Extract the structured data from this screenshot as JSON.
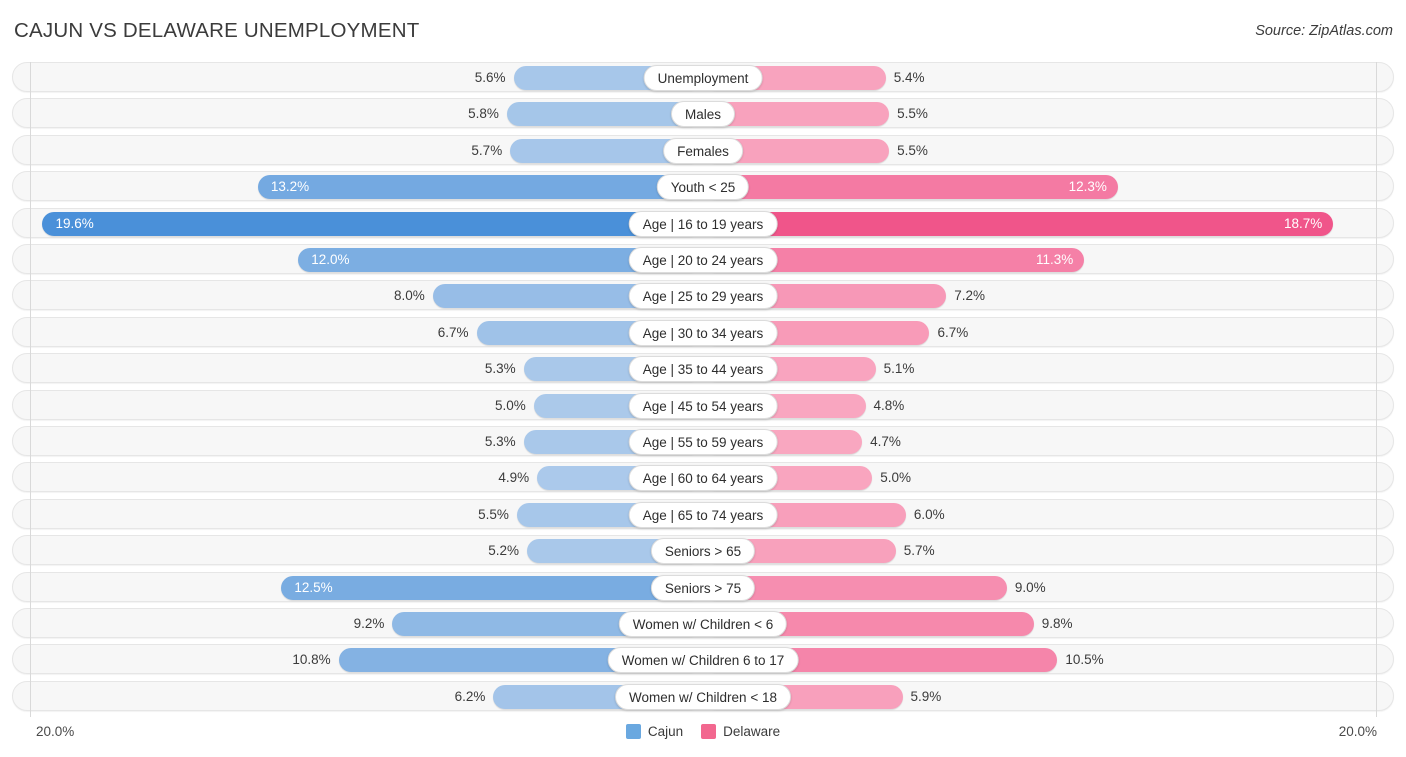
{
  "header": {
    "title": "CAJUN VS DELAWARE UNEMPLOYMENT",
    "source": "Source: ZipAtlas.com"
  },
  "axis": {
    "left_label": "20.0%",
    "right_label": "20.0%",
    "max": 20.0
  },
  "legend": {
    "items": [
      {
        "label": "Cajun",
        "color": "#6aa8e0"
      },
      {
        "label": "Delaware",
        "color": "#f2678f"
      }
    ]
  },
  "chart_data": {
    "type": "bar",
    "title": "CAJUN VS DELAWARE UNEMPLOYMENT",
    "subtitle": "Source: ZipAtlas.com",
    "orientation": "horizontal-diverging",
    "xlabel": "",
    "ylabel": "",
    "xlim": [
      -20.0,
      20.0
    ],
    "axis_tick_labels": [
      "20.0%",
      "20.0%"
    ],
    "grid": false,
    "legend_position": "bottom-center",
    "categories": [
      "Unemployment",
      "Males",
      "Females",
      "Youth < 25",
      "Age | 16 to 19 years",
      "Age | 20 to 24 years",
      "Age | 25 to 29 years",
      "Age | 30 to 34 years",
      "Age | 35 to 44 years",
      "Age | 45 to 54 years",
      "Age | 55 to 59 years",
      "Age | 60 to 64 years",
      "Age | 65 to 74 years",
      "Seniors > 65",
      "Seniors > 75",
      "Women w/ Children < 6",
      "Women w/ Children 6 to 17",
      "Women w/ Children < 18"
    ],
    "series": [
      {
        "name": "Cajun",
        "color": "#6aa8e0",
        "values": [
          5.6,
          5.8,
          5.7,
          13.2,
          19.6,
          12.0,
          8.0,
          6.7,
          5.3,
          5.0,
          5.3,
          4.9,
          5.5,
          5.2,
          12.5,
          9.2,
          10.8,
          6.2
        ],
        "labels": [
          "5.6%",
          "5.8%",
          "5.7%",
          "13.2%",
          "19.6%",
          "12.0%",
          "8.0%",
          "6.7%",
          "5.3%",
          "5.0%",
          "5.3%",
          "4.9%",
          "5.5%",
          "5.2%",
          "12.5%",
          "9.2%",
          "10.8%",
          "6.2%"
        ]
      },
      {
        "name": "Delaware",
        "color": "#f2678f",
        "values": [
          5.4,
          5.5,
          5.5,
          12.3,
          18.7,
          11.3,
          7.2,
          6.7,
          5.1,
          4.8,
          4.7,
          5.0,
          6.0,
          5.7,
          9.0,
          9.8,
          10.5,
          5.9
        ],
        "labels": [
          "5.4%",
          "5.5%",
          "5.5%",
          "12.3%",
          "18.7%",
          "11.3%",
          "7.2%",
          "6.7%",
          "5.1%",
          "4.8%",
          "4.7%",
          "5.0%",
          "6.0%",
          "5.7%",
          "9.0%",
          "9.8%",
          "10.5%",
          "5.9%"
        ]
      }
    ]
  },
  "rows": [
    {
      "category": "Unemployment",
      "left_value": 5.6,
      "left_label": "5.6%",
      "right_value": 5.4,
      "right_label": "5.4%"
    },
    {
      "category": "Males",
      "left_value": 5.8,
      "left_label": "5.8%",
      "right_value": 5.5,
      "right_label": "5.5%"
    },
    {
      "category": "Females",
      "left_value": 5.7,
      "left_label": "5.7%",
      "right_value": 5.5,
      "right_label": "5.5%"
    },
    {
      "category": "Youth < 25",
      "left_value": 13.2,
      "left_label": "13.2%",
      "right_value": 12.3,
      "right_label": "12.3%"
    },
    {
      "category": "Age | 16 to 19 years",
      "left_value": 19.6,
      "left_label": "19.6%",
      "right_value": 18.7,
      "right_label": "18.7%"
    },
    {
      "category": "Age | 20 to 24 years",
      "left_value": 12.0,
      "left_label": "12.0%",
      "right_value": 11.3,
      "right_label": "11.3%"
    },
    {
      "category": "Age | 25 to 29 years",
      "left_value": 8.0,
      "left_label": "8.0%",
      "right_value": 7.2,
      "right_label": "7.2%"
    },
    {
      "category": "Age | 30 to 34 years",
      "left_value": 6.7,
      "left_label": "6.7%",
      "right_value": 6.7,
      "right_label": "6.7%"
    },
    {
      "category": "Age | 35 to 44 years",
      "left_value": 5.3,
      "left_label": "5.3%",
      "right_value": 5.1,
      "right_label": "5.1%"
    },
    {
      "category": "Age | 45 to 54 years",
      "left_value": 5.0,
      "left_label": "5.0%",
      "right_value": 4.8,
      "right_label": "4.8%"
    },
    {
      "category": "Age | 55 to 59 years",
      "left_value": 5.3,
      "left_label": "5.3%",
      "right_value": 4.7,
      "right_label": "4.7%"
    },
    {
      "category": "Age | 60 to 64 years",
      "left_value": 4.9,
      "left_label": "4.9%",
      "right_value": 5.0,
      "right_label": "5.0%"
    },
    {
      "category": "Age | 65 to 74 years",
      "left_value": 5.5,
      "left_label": "5.5%",
      "right_value": 6.0,
      "right_label": "6.0%"
    },
    {
      "category": "Seniors > 65",
      "left_value": 5.2,
      "left_label": "5.2%",
      "right_value": 5.7,
      "right_label": "5.7%"
    },
    {
      "category": "Seniors > 75",
      "left_value": 12.5,
      "left_label": "12.5%",
      "right_value": 9.0,
      "right_label": "9.0%"
    },
    {
      "category": "Women w/ Children < 6",
      "left_value": 9.2,
      "left_label": "9.2%",
      "right_value": 9.8,
      "right_label": "9.8%"
    },
    {
      "category": "Women w/ Children 6 to 17",
      "left_value": 10.8,
      "left_label": "10.8%",
      "right_value": 10.5,
      "right_label": "10.5%"
    },
    {
      "category": "Women w/ Children < 18",
      "left_value": 6.2,
      "left_label": "6.2%",
      "right_value": 5.9,
      "right_label": "5.9%"
    }
  ]
}
